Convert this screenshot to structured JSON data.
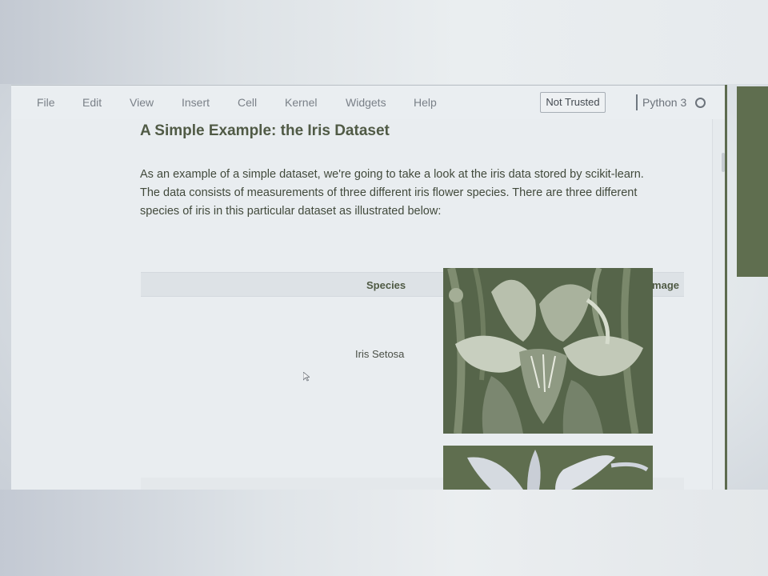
{
  "menu": {
    "file": "File",
    "edit": "Edit",
    "view": "View",
    "insert": "Insert",
    "cell": "Cell",
    "kernel": "Kernel",
    "widgets": "Widgets",
    "help": "Help"
  },
  "status": {
    "trust": "Not Trusted",
    "kernel_name": "Python 3"
  },
  "cell": {
    "heading": "A Simple Example: the Iris Dataset",
    "para_lines": [
      "As an example of a simple dataset, we're going to take a look at the iris data stored by scikit-learn.",
      "The data consists of measurements of three different iris flower species. There are three different",
      "species of iris in this particular dataset as illustrated below:"
    ]
  },
  "table": {
    "headers": {
      "species": "Species",
      "image": "Image"
    },
    "rows": [
      {
        "species": "Iris Setosa",
        "image_icon": "iris-setosa-photo"
      }
    ]
  },
  "colors": {
    "accent_green": "#5f6e4f",
    "heading_green": "#505a45"
  }
}
